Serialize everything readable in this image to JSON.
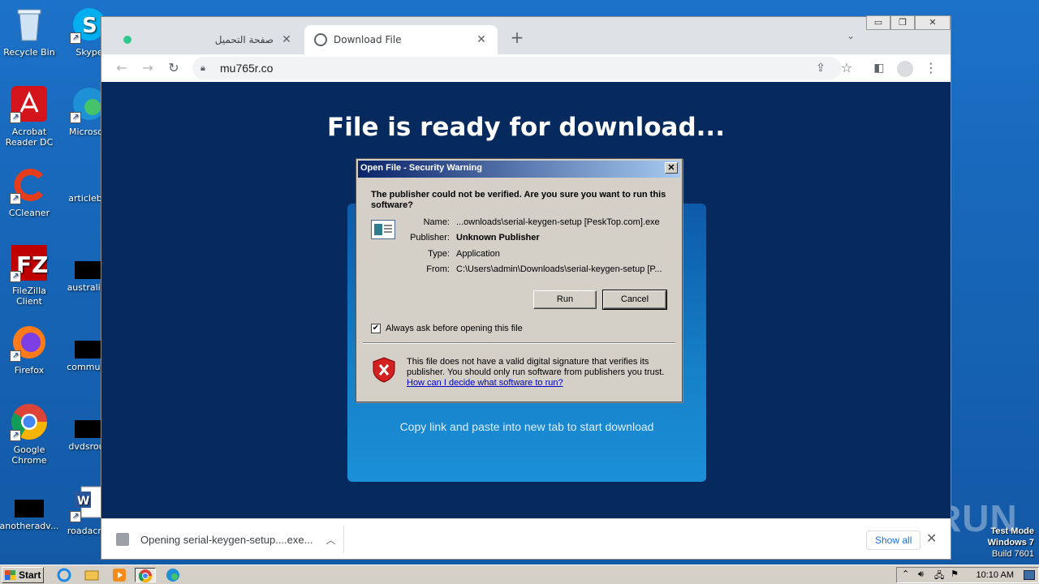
{
  "desktop": {
    "icons": [
      {
        "label": "Recycle Bin"
      },
      {
        "label": "Acrobat Reader DC"
      },
      {
        "label": "CCleaner"
      },
      {
        "label": "FileZilla Client"
      },
      {
        "label": "Firefox"
      },
      {
        "label": "Google Chrome"
      },
      {
        "label": "anotheradv..."
      },
      {
        "label": "Skype"
      },
      {
        "label": "Microsoft"
      },
      {
        "label": "articlebig"
      },
      {
        "label": "australian"
      },
      {
        "label": "communit"
      },
      {
        "label": "dvdsroun"
      },
      {
        "label": "roadacros"
      }
    ],
    "watermark": "ANY RUN",
    "test_mode": {
      "line1": "Test Mode",
      "line2": "Windows 7",
      "line3": "Build 7601"
    }
  },
  "browser": {
    "tabs": [
      {
        "title": "صفحة التحميل",
        "active": false
      },
      {
        "title": "Download File",
        "active": true
      }
    ],
    "address": "mu765r.co",
    "window_controls": {
      "minimize": "▭",
      "restore": "❐",
      "close": "✕"
    }
  },
  "page": {
    "heading": "File is ready for download...",
    "card_text": "Copy link and paste into new tab to start download"
  },
  "download_shelf": {
    "item": "Opening serial-keygen-setup....exe...",
    "show_all": "Show all"
  },
  "dialog": {
    "title": "Open File - Security Warning",
    "question": "The publisher could not be verified.  Are you sure you want to run this software?",
    "fields": [
      {
        "key": "Name:",
        "value": "...ownloads\\serial-keygen-setup [PeskTop.com].exe",
        "bold": false
      },
      {
        "key": "Publisher:",
        "value": "Unknown Publisher",
        "bold": true
      },
      {
        "key": "Type:",
        "value": "Application",
        "bold": false
      },
      {
        "key": "From:",
        "value": "C:\\Users\\admin\\Downloads\\serial-keygen-setup [P...",
        "bold": false
      }
    ],
    "run_label": "Run",
    "cancel_label": "Cancel",
    "checkbox_label": "Always ask before opening this file",
    "checkbox_checked": true,
    "warning": "This file does not have a valid digital signature that verifies its publisher.  You should only run software from publishers you trust.",
    "link": "How can I decide what software to run?"
  },
  "taskbar": {
    "start_label": "Start",
    "clock": "10:10 AM"
  }
}
